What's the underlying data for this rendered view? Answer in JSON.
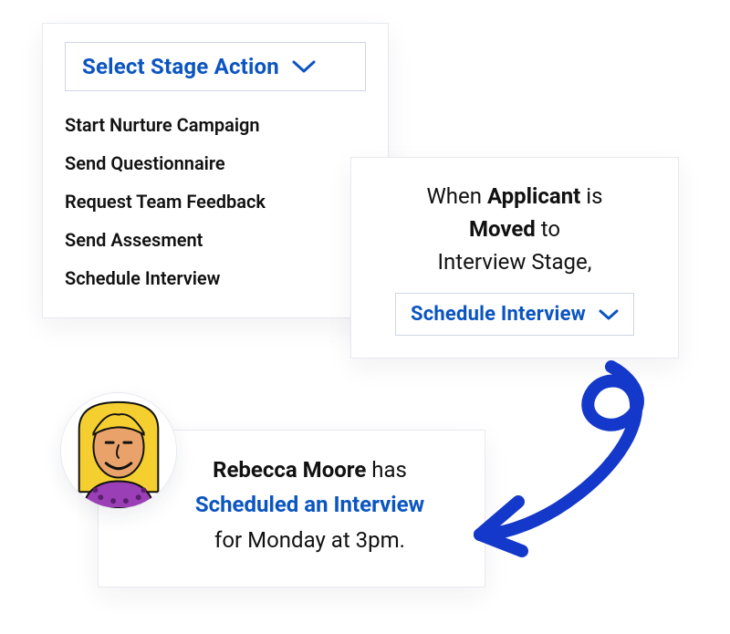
{
  "stageActions": {
    "selectLabel": "Select Stage Action",
    "options": [
      "Start Nurture Campaign",
      "Send Questionnaire",
      "Request Team Feedback",
      "Send Assesment",
      "Schedule Interview"
    ]
  },
  "rule": {
    "prefix": "When ",
    "entity": "Applicant",
    "mid1": " is ",
    "verb": "Moved",
    "mid2": " to",
    "stage": "Interview Stage,",
    "selectedAction": "Schedule Interview"
  },
  "notification": {
    "name": "Rebecca Moore",
    "has": " has",
    "action": "Scheduled an Interview",
    "whenPrefix": "for ",
    "when": "Monday at 3pm."
  },
  "colors": {
    "accent": "#0b55c1"
  }
}
